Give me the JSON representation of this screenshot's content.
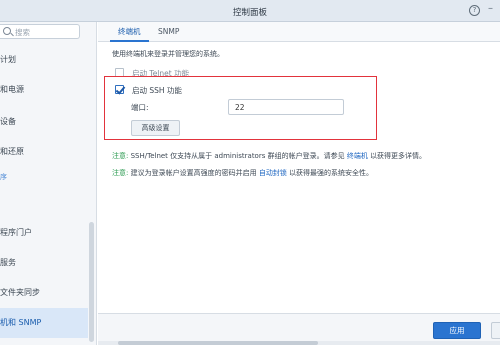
{
  "window": {
    "title": "控制面板",
    "help_icon": "help-icon",
    "help_glyph": "?",
    "minimize_glyph": "–"
  },
  "sidebar": {
    "search_placeholder": "搜索",
    "items": [
      {
        "label": "计划"
      },
      {
        "label": "和电源"
      },
      {
        "label": "设备"
      },
      {
        "label": "和还原"
      },
      {
        "label": "程序门户"
      },
      {
        "label": "服务"
      },
      {
        "label": "文件夹同步"
      },
      {
        "label": "机和 SNMP"
      }
    ],
    "group_label": "序"
  },
  "tabs": [
    {
      "label": "终端机"
    },
    {
      "label": "SNMP"
    }
  ],
  "main": {
    "description": "使用终端机来登录并管理您的系统。",
    "telnet": {
      "label": "启动 Telnet 功能",
      "checked": false
    },
    "ssh": {
      "label": "启动 SSH 功能",
      "checked": true
    },
    "port_label": "端口:",
    "port_value": "22",
    "advanced_button": "高级设置",
    "note1": {
      "tag": "注意:",
      "text": "SSH/Telnet 仅支持从属于 administrators 群组的帐户登录。请参见",
      "link": "终端机",
      "suffix": "以获得更多详情。"
    },
    "note2": {
      "tag": "注意:",
      "text": "建议为登录帐户设置高强度的密码并启用",
      "link": "自动封锁",
      "suffix": "以获得最强的系统安全性。"
    }
  },
  "footer": {
    "apply_button": "应用"
  },
  "colors": {
    "accent": "#2a74d0",
    "highlight_box": "#e2333c",
    "note_tag": "#2b9b51"
  }
}
